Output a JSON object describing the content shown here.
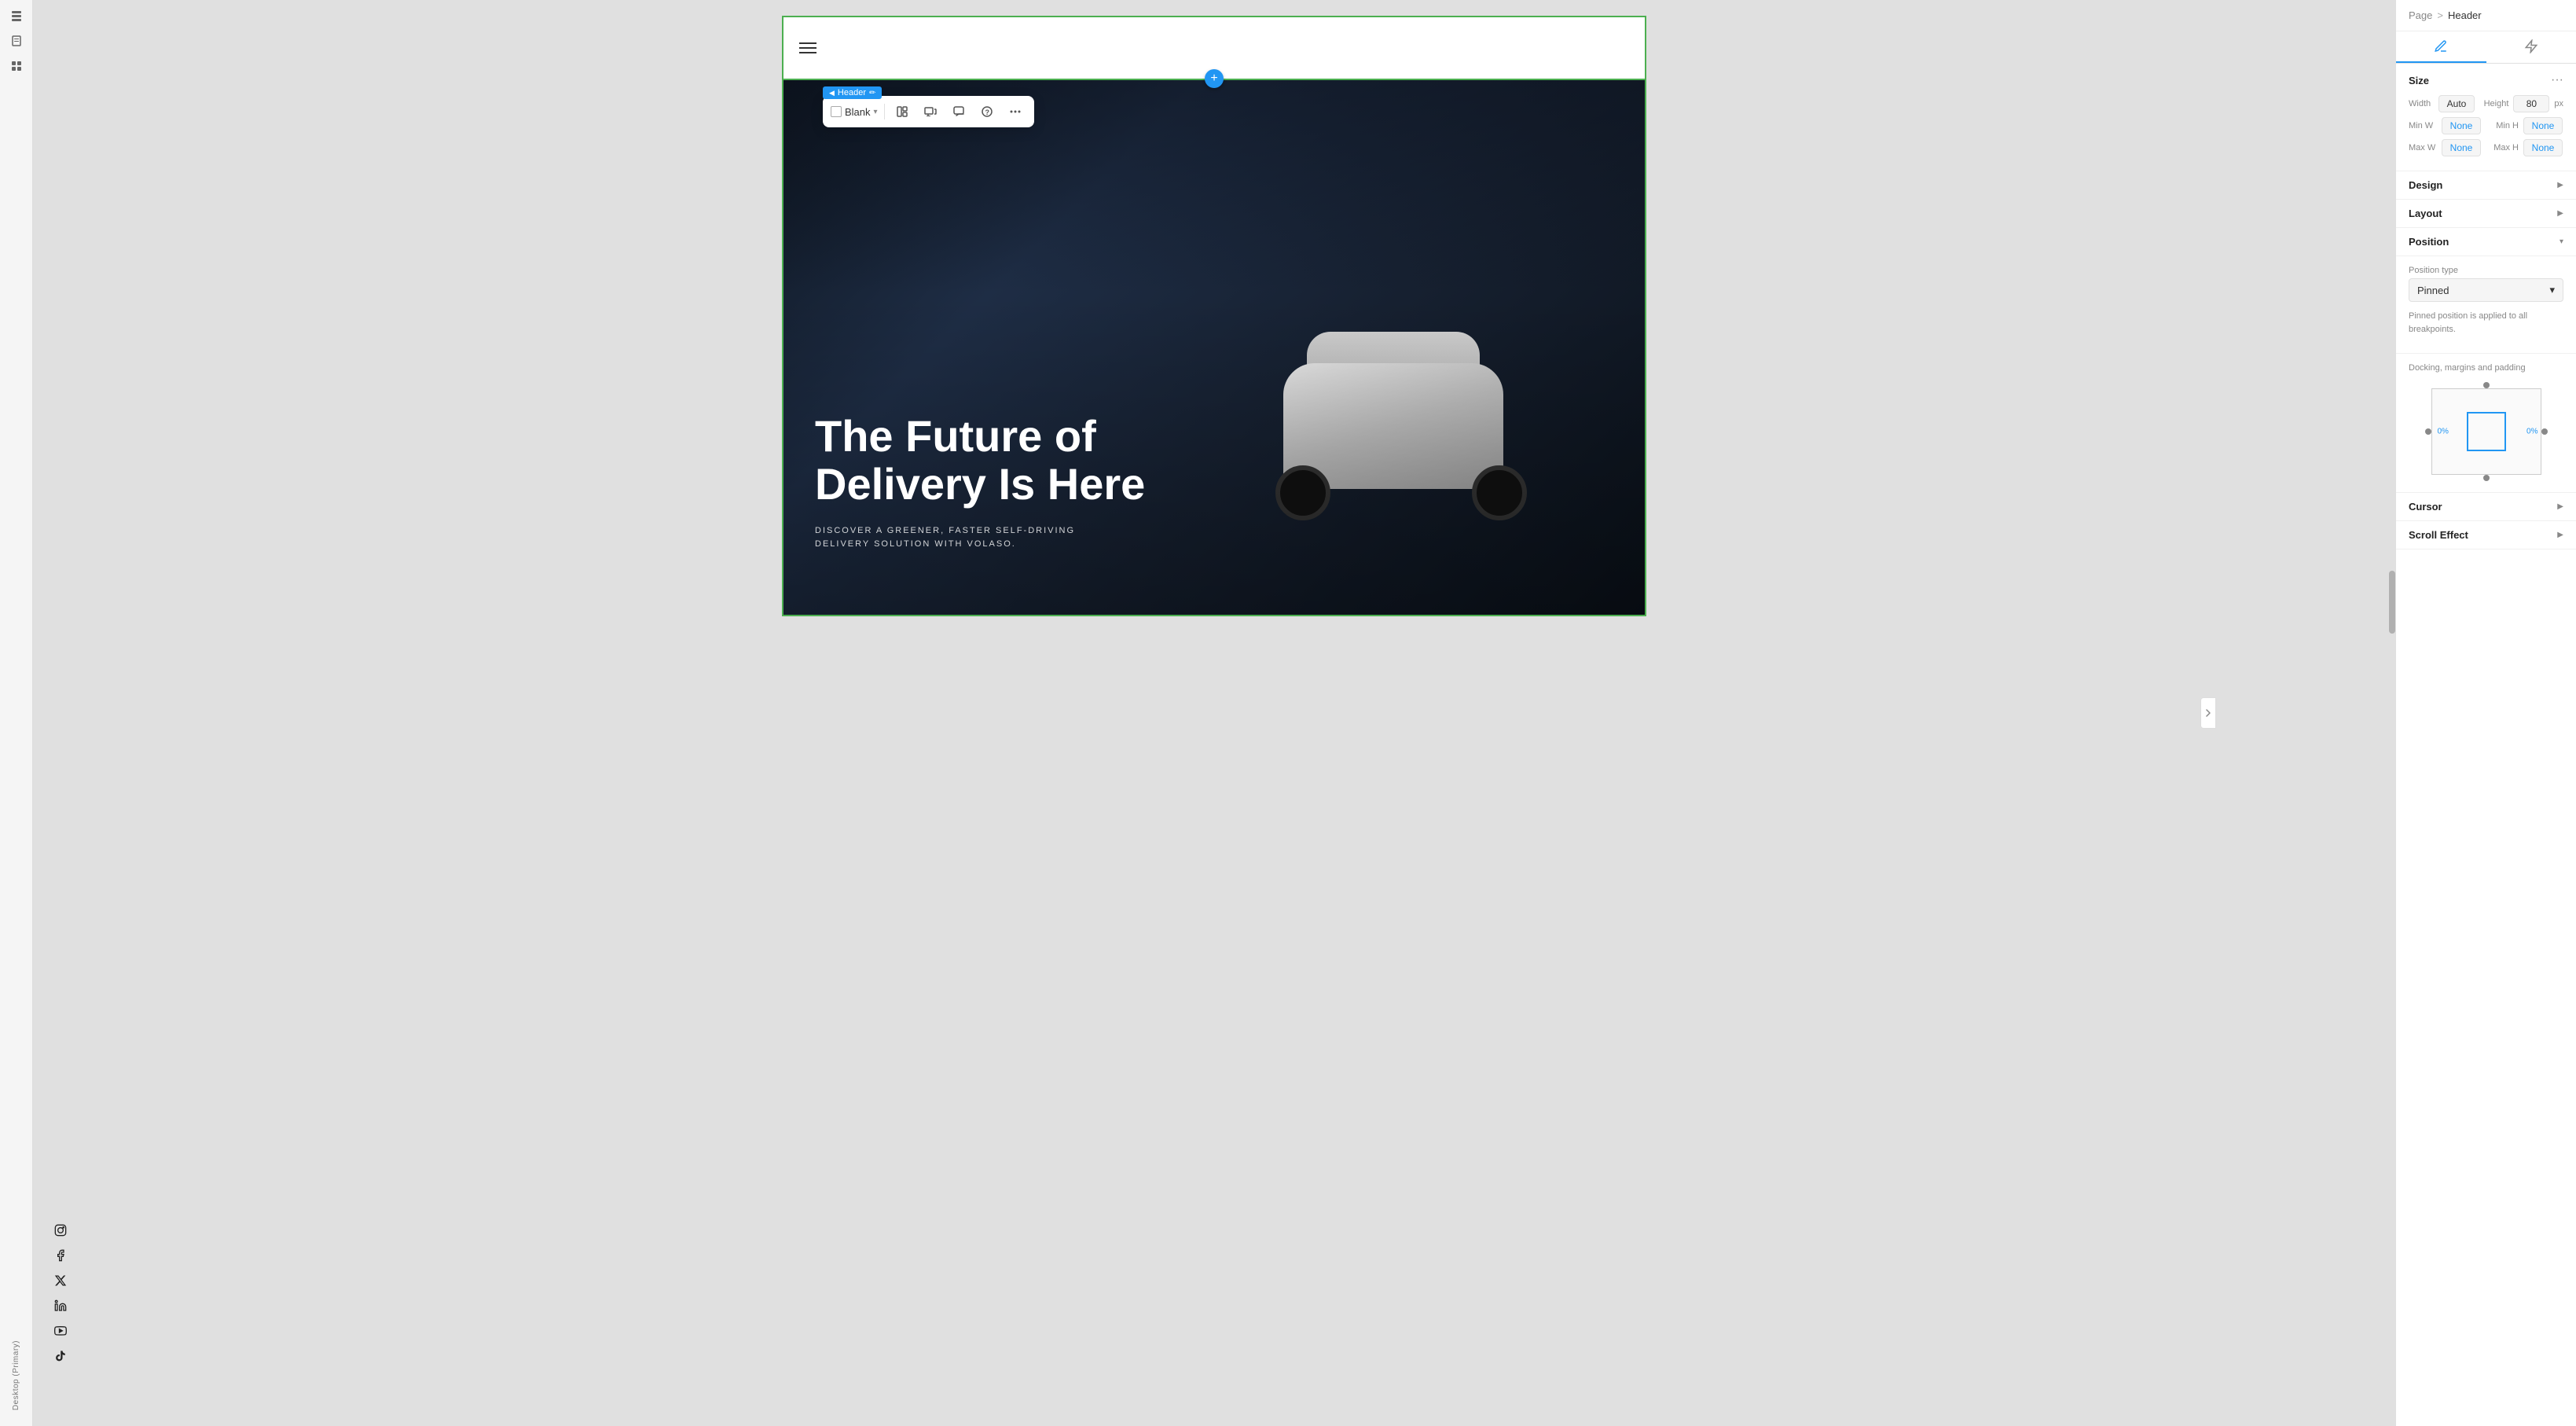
{
  "breadcrumb": {
    "parent": "Page",
    "separator": ">",
    "current": "Header"
  },
  "tabs": [
    {
      "id": "design",
      "label": "Design tab",
      "active": true
    },
    {
      "id": "lightning",
      "label": "Lightning tab",
      "active": false
    }
  ],
  "size_section": {
    "title": "Size",
    "width_label": "Width",
    "width_value": "Auto",
    "height_label": "Height",
    "height_value": "80",
    "height_unit": "px",
    "min_w_label": "Min W",
    "min_w_value": "None",
    "min_h_label": "Min H",
    "min_h_value": "None",
    "max_w_label": "Max W",
    "max_w_value": "None",
    "max_h_label": "Max H",
    "max_h_value": "None"
  },
  "design_section": {
    "title": "Design",
    "arrow": "▶"
  },
  "layout_section": {
    "title": "Layout",
    "arrow": "▶"
  },
  "position_section": {
    "title": "Position",
    "arrow": "▾",
    "position_type_label": "Position type",
    "position_type_value": "Pinned",
    "pinned_note": "Pinned position is applied to all breakpoints.",
    "docking_title": "Docking, margins and padding",
    "dock_left": "0%",
    "dock_right": "0%"
  },
  "cursor_section": {
    "title": "Cursor",
    "arrow": "▶"
  },
  "scroll_effect_section": {
    "title": "Scroll Effect",
    "arrow": "▶"
  },
  "toolbar": {
    "blank_label": "Blank",
    "chevron": "▾"
  },
  "header_badge": {
    "label": "Header",
    "edit_icon": "✏"
  },
  "hero": {
    "title_line1": "The Future of",
    "title_line2": "Delivery Is Here",
    "subtitle_line1": "DISCOVER A GREENER, FASTER SELF-DRIVING",
    "subtitle_line2": "DELIVERY SOLUTION WITH VOLASO."
  },
  "sidebar": {
    "desktop_label": "Desktop (Primary)"
  },
  "social_icons": [
    {
      "name": "instagram",
      "symbol": "◎"
    },
    {
      "name": "facebook",
      "symbol": "f"
    },
    {
      "name": "twitter-x",
      "symbol": "✕"
    },
    {
      "name": "linkedin",
      "symbol": "in"
    },
    {
      "name": "youtube",
      "symbol": "▶"
    },
    {
      "name": "tiktok",
      "symbol": "♪"
    }
  ],
  "add_button": {
    "label": "+"
  },
  "colors": {
    "accent_blue": "#2196F3",
    "header_border": "#4CAF50",
    "badge_bg": "#2196F3"
  }
}
